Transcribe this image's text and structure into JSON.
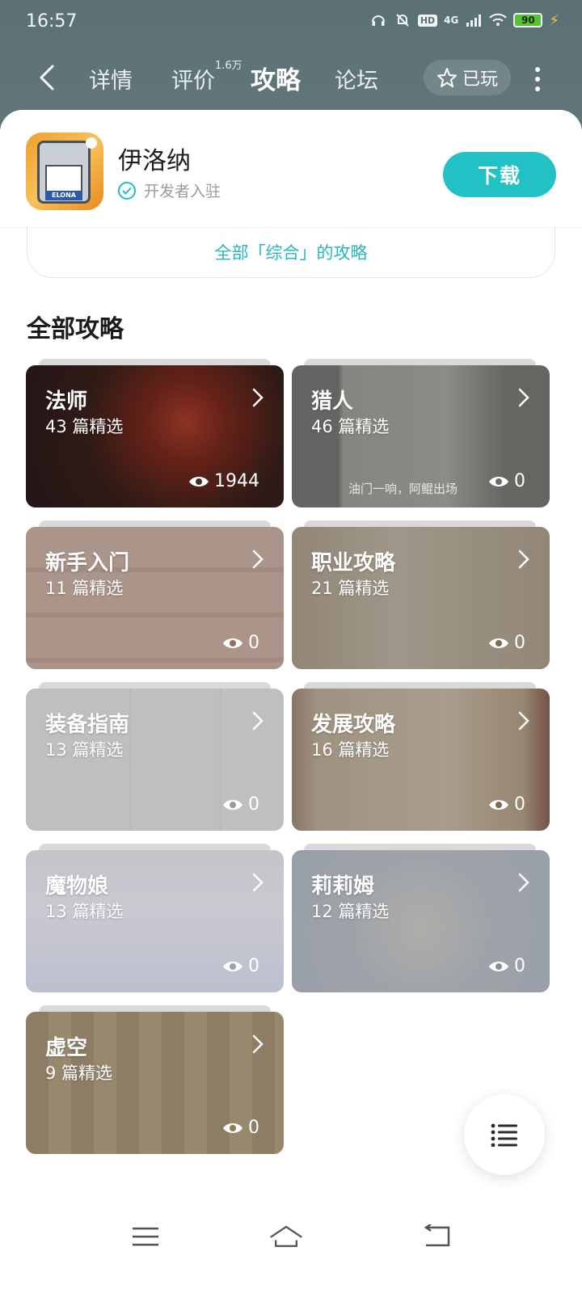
{
  "status_bar": {
    "time": "16:57",
    "network": "4G",
    "battery": "90",
    "hd": "HD"
  },
  "nav": {
    "tabs": [
      {
        "label": "详情",
        "active": false
      },
      {
        "label": "评价",
        "active": false,
        "superscript": "1.6万"
      },
      {
        "label": "攻略",
        "active": true
      },
      {
        "label": "论坛",
        "active": false
      }
    ],
    "played_label": "已玩"
  },
  "app": {
    "name": "伊洛纳",
    "dev_badge": "开发者入驻",
    "icon_logo_text": "ELONA",
    "download_label": "下载"
  },
  "all_combined_label": "全部「综合」的攻略",
  "section_title": "全部攻略",
  "cards": [
    {
      "title": "法师",
      "count": "43 篇精选",
      "views": "1944"
    },
    {
      "title": "猎人",
      "count": "46 篇精选",
      "views": "0"
    },
    {
      "title": "新手入门",
      "count": "11 篇精选",
      "views": "0"
    },
    {
      "title": "职业攻略",
      "count": "21 篇精选",
      "views": "0"
    },
    {
      "title": "装备指南",
      "count": "13 篇精选",
      "views": "0"
    },
    {
      "title": "发展攻略",
      "count": "16 篇精选",
      "views": "0"
    },
    {
      "title": "魔物娘",
      "count": "13 篇精选",
      "views": "0"
    },
    {
      "title": "莉莉姆",
      "count": "12 篇精选",
      "views": "0"
    },
    {
      "title": "虚空",
      "count": "9 篇精选",
      "views": "0"
    }
  ],
  "hunter_caption": "油门一响，阿鲲出场",
  "colors": {
    "accent": "#21c1c6",
    "header_bg": "#5e7377"
  }
}
